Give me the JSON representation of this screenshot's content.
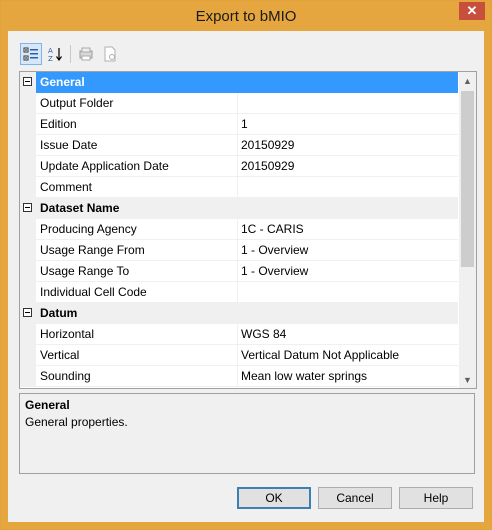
{
  "window": {
    "title": "Export to bMIO",
    "close_glyph": "✕"
  },
  "toolbar": {
    "buttons": [
      {
        "name": "categorized-view-icon",
        "active": true
      },
      {
        "name": "alphabetical-sort-icon",
        "active": false
      },
      {
        "name": "property-pages-icon",
        "active": false
      },
      {
        "name": "print-preview-icon",
        "active": false
      }
    ]
  },
  "grid": {
    "categories": [
      {
        "label": "General",
        "selected": true,
        "rows": [
          {
            "name": "Output Folder",
            "value": ""
          },
          {
            "name": "Edition",
            "value": "1"
          },
          {
            "name": "Issue Date",
            "value": "20150929"
          },
          {
            "name": "Update Application Date",
            "value": "20150929"
          },
          {
            "name": "Comment",
            "value": ""
          }
        ]
      },
      {
        "label": "Dataset Name",
        "selected": false,
        "rows": [
          {
            "name": "Producing Agency",
            "value": "1C - CARIS"
          },
          {
            "name": "Usage Range From",
            "value": "1 - Overview"
          },
          {
            "name": "Usage Range To",
            "value": "1 - Overview"
          },
          {
            "name": "Individual Cell Code",
            "value": ""
          }
        ]
      },
      {
        "label": "Datum",
        "selected": false,
        "rows": [
          {
            "name": "Horizontal",
            "value": "WGS 84"
          },
          {
            "name": "Vertical",
            "value": "Vertical Datum Not Applicable"
          },
          {
            "name": "Sounding",
            "value": "Mean low water springs"
          }
        ]
      }
    ]
  },
  "description": {
    "title": "General",
    "text": "General properties."
  },
  "buttons": {
    "ok": "OK",
    "cancel": "Cancel",
    "help": "Help"
  },
  "colors": {
    "titlebar": "#e5a53f",
    "selection": "#3399ff",
    "close": "#c74f3c"
  }
}
